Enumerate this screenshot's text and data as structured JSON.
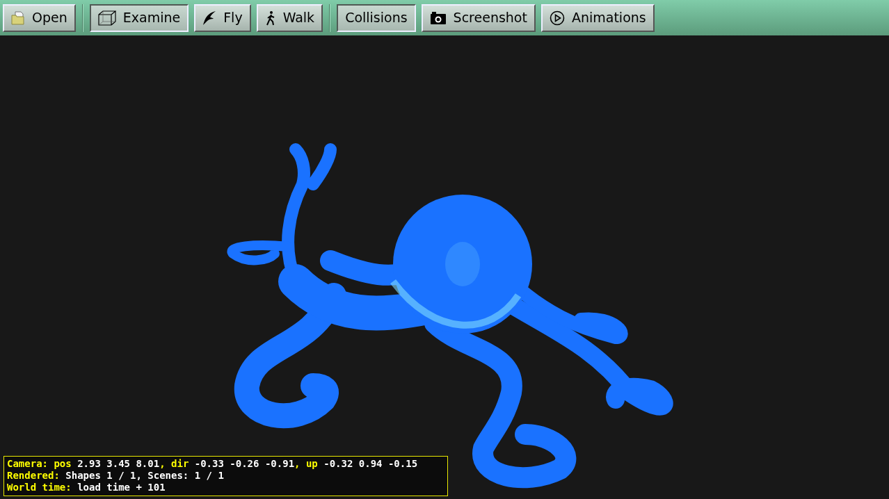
{
  "toolbar": {
    "groups": [
      [
        {
          "label": "Open",
          "kind": "folder",
          "pressed": false
        }
      ],
      [
        {
          "label": "Examine",
          "kind": "cube",
          "pressed": true
        },
        {
          "label": "Fly",
          "kind": "bird",
          "pressed": false
        },
        {
          "label": "Walk",
          "kind": "walker",
          "pressed": false
        }
      ],
      [
        {
          "label": "Collisions",
          "kind": "plain",
          "pressed": true
        },
        {
          "label": "Screenshot",
          "kind": "camera",
          "pressed": false
        },
        {
          "label": "Animations",
          "kind": "play",
          "pressed": false
        }
      ]
    ]
  },
  "status": {
    "lines": [
      [
        {
          "text": "Camera: pos",
          "kind": "label"
        },
        {
          "text": "2.93 3.45 8.01",
          "kind": "value"
        },
        {
          "text": ", dir",
          "kind": "label"
        },
        {
          "text": "-0.33 -0.26 -0.91",
          "kind": "value"
        },
        {
          "text": ", up",
          "kind": "label"
        },
        {
          "text": "-0.32 0.94 -0.15",
          "kind": "value"
        }
      ],
      [
        {
          "text": "Rendered:",
          "kind": "label"
        },
        {
          "text": "Shapes 1 / 1, Scenes: 1 / 1",
          "kind": "value"
        }
      ],
      [
        {
          "text": "World time:",
          "kind": "label"
        },
        {
          "text": "load time + 101",
          "kind": "value"
        }
      ]
    ]
  }
}
